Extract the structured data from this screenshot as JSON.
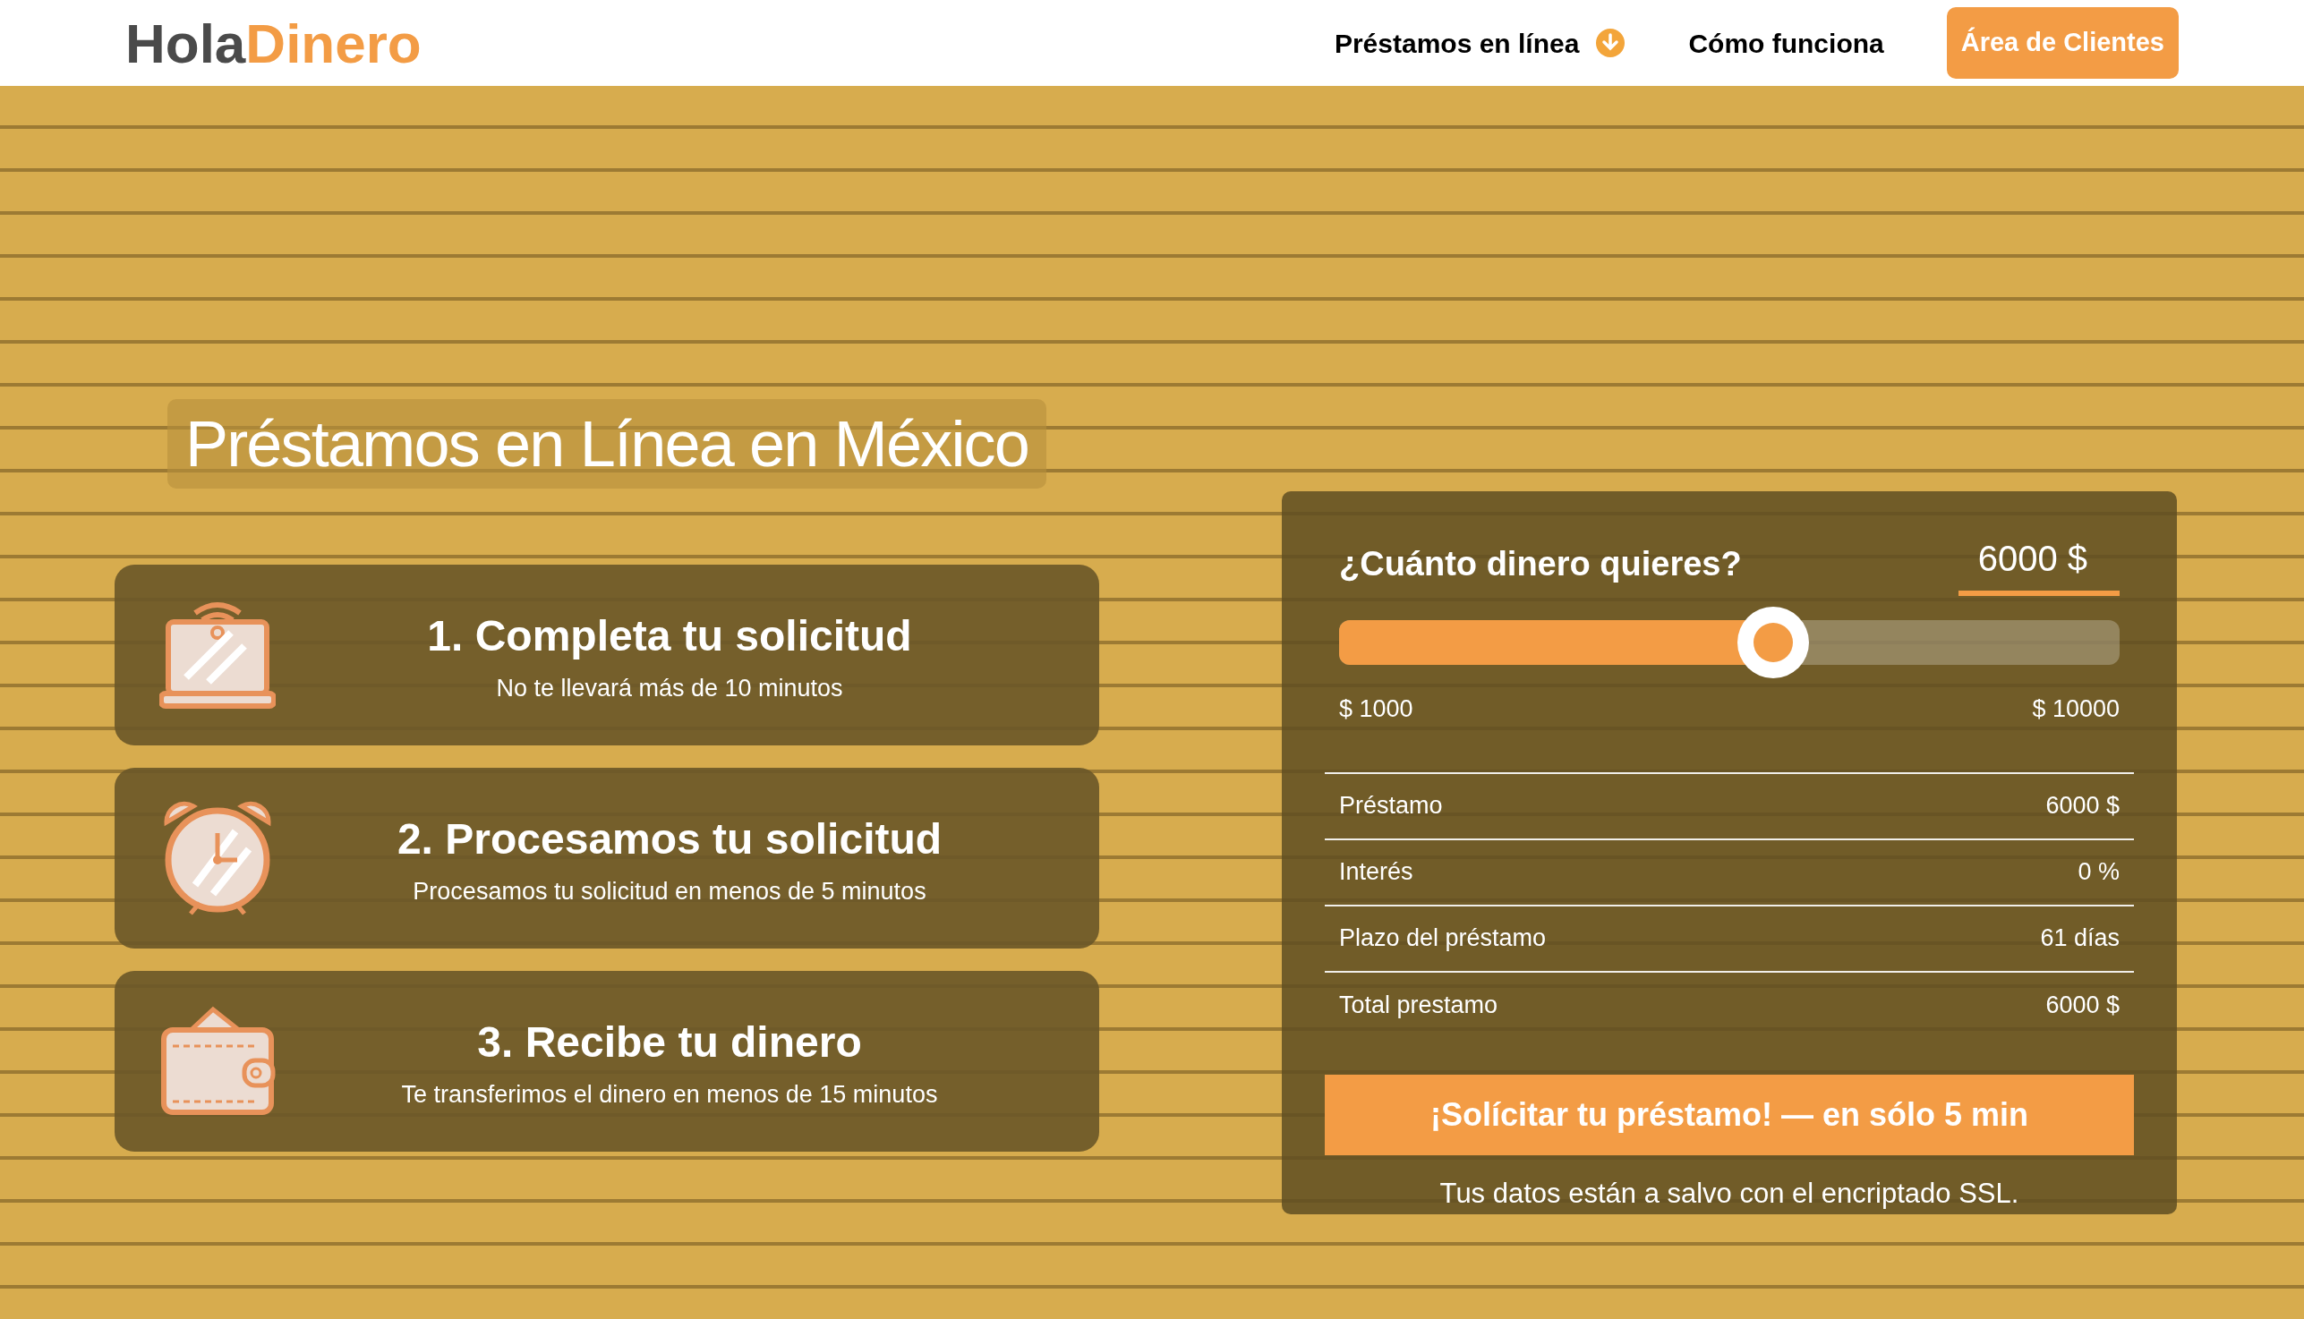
{
  "header": {
    "logo": {
      "part_1": "Hola",
      "part_2": "Dinero"
    },
    "nav": [
      {
        "label": "Préstamos en línea",
        "has_dropdown": true
      },
      {
        "label": "Cómo funciona",
        "has_dropdown": false
      }
    ],
    "client_button": "Área de Clientes"
  },
  "hero": {
    "title": "Préstamos en Línea en México"
  },
  "steps": [
    {
      "kind": "laptop",
      "title": "1. Completa tu solicitud",
      "subtitle": "No te llevará más de 10 minutos"
    },
    {
      "kind": "clock",
      "title": "2. Procesamos tu solicitud",
      "subtitle": "Procesamos tu solicitud en menos de 5 minutos"
    },
    {
      "kind": "wallet",
      "title": "3. Recibe tu dinero",
      "subtitle": "Te transferimos el dinero en menos de 15 minutos"
    }
  ],
  "calculator": {
    "question": "¿Cuánto dinero quieres?",
    "amount": "6000 $",
    "slider": {
      "level": 0.556,
      "min_label": "$ 1000",
      "max_label": "$ 10000"
    },
    "summary": [
      {
        "label": "Préstamo",
        "value": "6000 $"
      },
      {
        "label": "Interés",
        "value": "0 %"
      },
      {
        "label": "Plazo del préstamo",
        "value": "61 días"
      },
      {
        "label": "Total prestamo",
        "value": "6000 $"
      }
    ],
    "button": "¡Solícitar tu préstamo! — en sólo 5 min",
    "note": "Tus datos están a salvo con el encriptado SSL."
  }
}
